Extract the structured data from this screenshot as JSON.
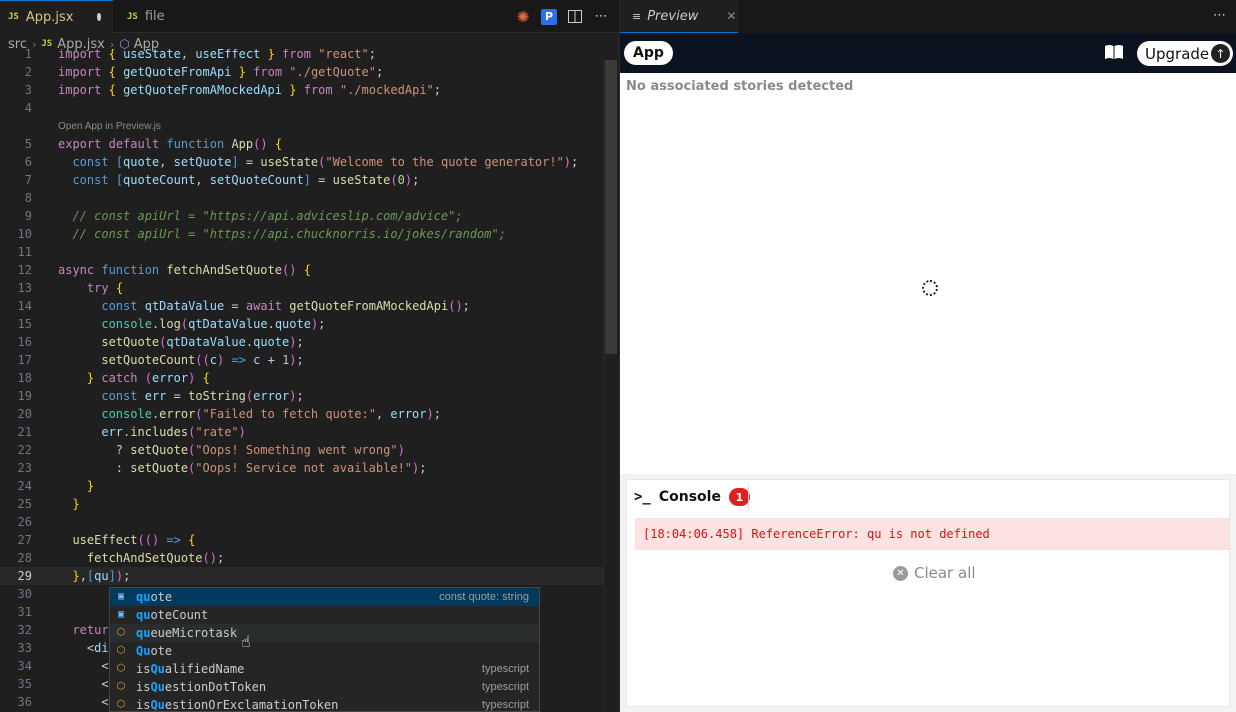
{
  "editor": {
    "tabs": [
      {
        "icon": "JS",
        "label": "App.jsx",
        "modified": true
      },
      {
        "icon": "JS",
        "label": "file"
      }
    ],
    "breadcrumb": [
      "src",
      "App.jsx",
      "App"
    ],
    "codelens": "Open App in Preview.js",
    "lines": [
      {
        "n": "1",
        "t": "import { useState, useEffect } from \"react\";"
      },
      {
        "n": "2",
        "t": "import { getQuoteFromApi } from \"./getQuote\";"
      },
      {
        "n": "3",
        "t": "import { getQuoteFromAMockedApi } from \"./mockedApi\";"
      },
      {
        "n": "4",
        "t": ""
      },
      {
        "n": "5",
        "t": "export default function App() {"
      },
      {
        "n": "6",
        "t": "  const [quote, setQuote] = useState(\"Welcome to the quote generator!\");"
      },
      {
        "n": "7",
        "t": "  const [quoteCount, setQuoteCount] = useState(0);"
      },
      {
        "n": "8",
        "t": ""
      },
      {
        "n": "9",
        "t": "  // const apiUrl = \"https://api.adviceslip.com/advice\";"
      },
      {
        "n": "10",
        "t": "  // const apiUrl = \"https://api.chucknorris.io/jokes/random\";"
      },
      {
        "n": "11",
        "t": ""
      },
      {
        "n": "12",
        "t": "async function fetchAndSetQuote() {"
      },
      {
        "n": "13",
        "t": "    try {"
      },
      {
        "n": "14",
        "t": "      const qtDataValue = await getQuoteFromAMockedApi();"
      },
      {
        "n": "15",
        "t": "      console.log(qtDataValue.quote);"
      },
      {
        "n": "16",
        "t": "      setQuote(qtDataValue.quote);"
      },
      {
        "n": "17",
        "t": "      setQuoteCount((c) => c + 1);"
      },
      {
        "n": "18",
        "t": "    } catch (error) {"
      },
      {
        "n": "19",
        "t": "      const err = toString(error);"
      },
      {
        "n": "20",
        "t": "      console.error(\"Failed to fetch quote:\", error);"
      },
      {
        "n": "21",
        "t": "      err.includes(\"rate\")"
      },
      {
        "n": "22",
        "t": "        ? setQuote(\"Oops! Something went wrong\")"
      },
      {
        "n": "23",
        "t": "        : setQuote(\"Oops! Service not available!\");"
      },
      {
        "n": "24",
        "t": "    }"
      },
      {
        "n": "25",
        "t": "  }"
      },
      {
        "n": "26",
        "t": ""
      },
      {
        "n": "27",
        "t": "  useEffect(() => {"
      },
      {
        "n": "28",
        "t": "    fetchAndSetQuote();"
      },
      {
        "n": "29",
        "t": "  },[qu]);"
      },
      {
        "n": "30",
        "t": ""
      },
      {
        "n": "31",
        "t": ""
      },
      {
        "n": "32",
        "t": "  retur"
      },
      {
        "n": "33",
        "t": "    <di"
      },
      {
        "n": "34",
        "t": "      <"
      },
      {
        "n": "35",
        "t": "      <"
      },
      {
        "n": "36",
        "t": "      <"
      }
    ],
    "suggestions": [
      {
        "match": "qu",
        "rest": "ote",
        "detail": "const quote: string",
        "kind": "var"
      },
      {
        "match": "qu",
        "rest": "oteCount",
        "detail": "",
        "kind": "var"
      },
      {
        "match": "qu",
        "rest": "eueMicrotask",
        "detail": "",
        "kind": "box"
      },
      {
        "match": "Qu",
        "rest": "ote",
        "detail": "",
        "kind": "box"
      },
      {
        "pre": "is",
        "match": "Qu",
        "rest": "alifiedName",
        "detail": "typescript",
        "kind": "box"
      },
      {
        "pre": "is",
        "match": "Qu",
        "rest": "estionDotToken",
        "detail": "typescript",
        "kind": "box"
      },
      {
        "pre": "is",
        "match": "Qu",
        "rest": "estionOrExclamationToken",
        "detail": "typescript",
        "kind": "box"
      }
    ]
  },
  "preview": {
    "tab_label": "Preview",
    "app_button": "App",
    "upgrade_label": "Upgrade",
    "no_stories": "No associated stories detected",
    "console": {
      "title": "Console",
      "count": "1",
      "error": "[18:04:06.458] ReferenceError: qu is not defined",
      "clear_label": "Clear all"
    }
  },
  "colors": {
    "accent": "#0078d4",
    "error": "#dd1111",
    "badge": "#e02020"
  }
}
